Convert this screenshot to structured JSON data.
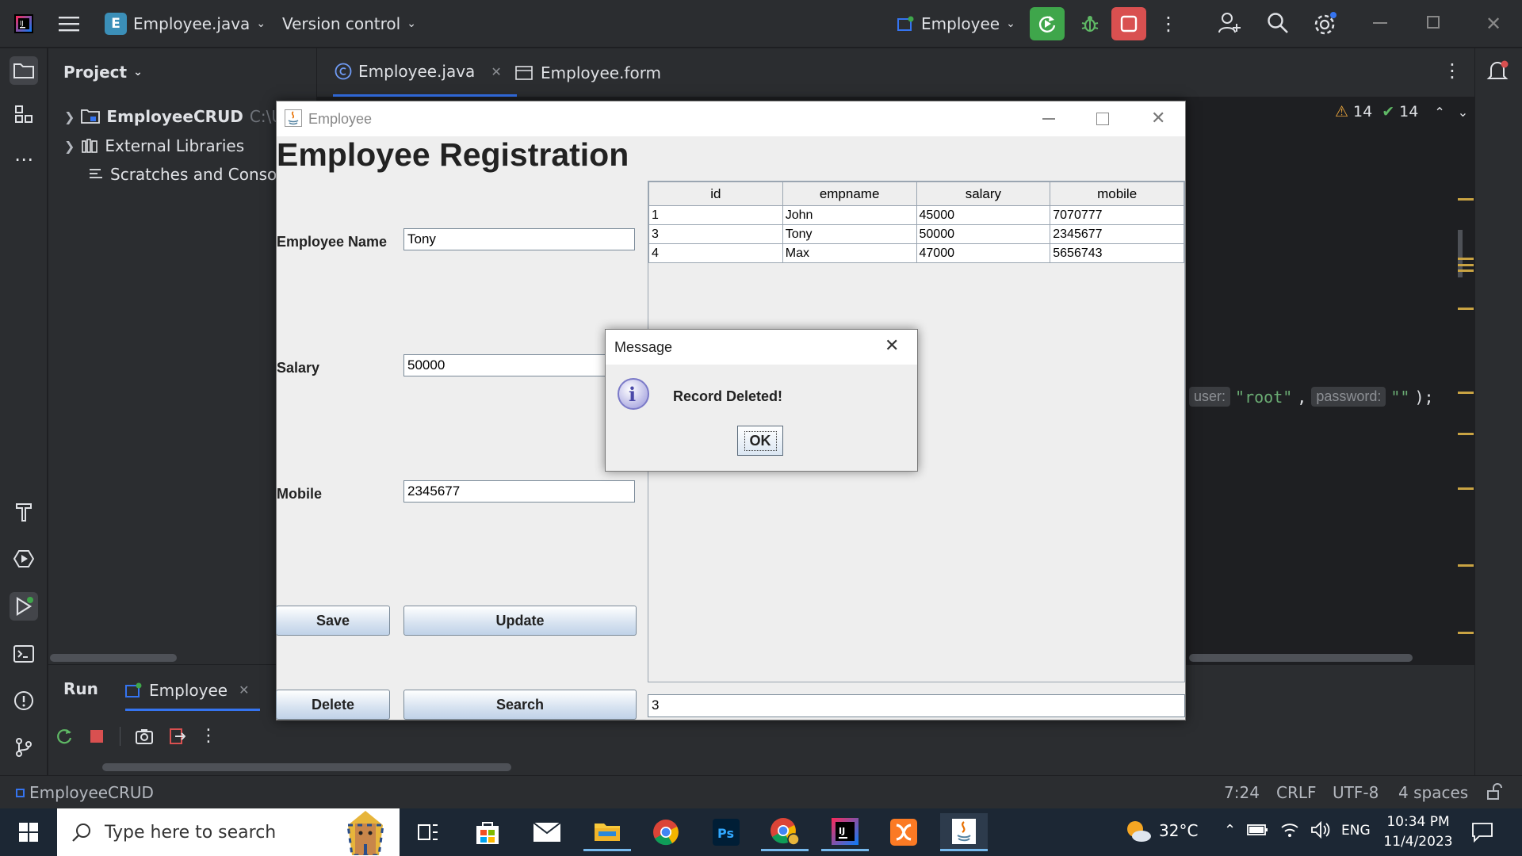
{
  "ide": {
    "project_badge": "E",
    "project_name": "Employee.java",
    "vcs_label": "Version control",
    "run_config": "Employee",
    "colors": {
      "run_green": "#3fa64b",
      "stop_red": "#d95050",
      "accent_blue": "#3574f0"
    }
  },
  "project_panel": {
    "title": "Project",
    "items": [
      {
        "label": "EmployeeCRUD",
        "path_hint": "C:\\U"
      },
      {
        "label": "External Libraries"
      },
      {
        "label": "Scratches and Console"
      }
    ]
  },
  "editor": {
    "tabs": [
      {
        "label": "Employee.java",
        "active": true
      },
      {
        "label": "Employee.form",
        "active": false
      }
    ],
    "warnings": "14",
    "weak_warnings": "14",
    "code_fragment": {
      "hint_user": "user:",
      "user_value": "\"root\"",
      "comma": ",",
      "hint_password": "password:",
      "password_value": "\"\"",
      "tail": ");"
    }
  },
  "run_panel": {
    "title": "Run",
    "tab_label": "Employee"
  },
  "statusbar": {
    "project": "EmployeeCRUD",
    "position": "7:24",
    "line_sep": "CRLF",
    "encoding": "UTF-8",
    "indent": "4 spaces"
  },
  "taskbar": {
    "search_placeholder": "Type here to search",
    "temperature": "32°C",
    "language": "ENG",
    "time": "10:34 PM",
    "date": "11/4/2023"
  },
  "swing_window": {
    "title": "Employee",
    "heading": "Employee Registration",
    "labels": {
      "name": "Employee Name",
      "salary": "Salary",
      "mobile": "Mobile"
    },
    "values": {
      "name": "Tony",
      "salary": "50000",
      "mobile": "2345677",
      "search": "3"
    },
    "buttons": {
      "save": "Save",
      "update": "Update",
      "delete": "Delete",
      "search": "Search"
    },
    "table": {
      "columns": [
        "id",
        "empname",
        "salary",
        "mobile"
      ],
      "rows": [
        [
          "1",
          "John",
          "45000",
          "7070777"
        ],
        [
          "3",
          "Tony",
          "50000",
          "2345677"
        ],
        [
          "4",
          "Max",
          "47000",
          "5656743"
        ]
      ]
    }
  },
  "dialog": {
    "title": "Message",
    "message": "Record Deleted!",
    "ok": "OK"
  }
}
